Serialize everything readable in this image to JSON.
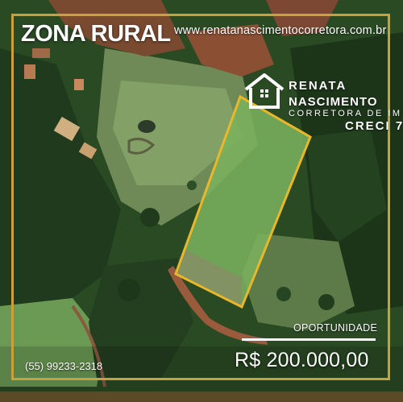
{
  "listing": {
    "title": "ZONA RURAL",
    "website": "www.renatanascimentocorretora.com.br",
    "tag": "OPORTUNIDADE",
    "price": "R$ 200.000,00",
    "phone": "(55) 99233-2318"
  },
  "brand": {
    "line1": "RENATA",
    "line2": "NASCIMENTO",
    "line3": "CORRETORA DE IM",
    "line4": "CRECI 7"
  },
  "icons": {
    "logo": "house-logo-icon"
  },
  "colors": {
    "frame": "#c9a13b",
    "plot_outline": "#e8b82a",
    "text": "#ffffff"
  }
}
